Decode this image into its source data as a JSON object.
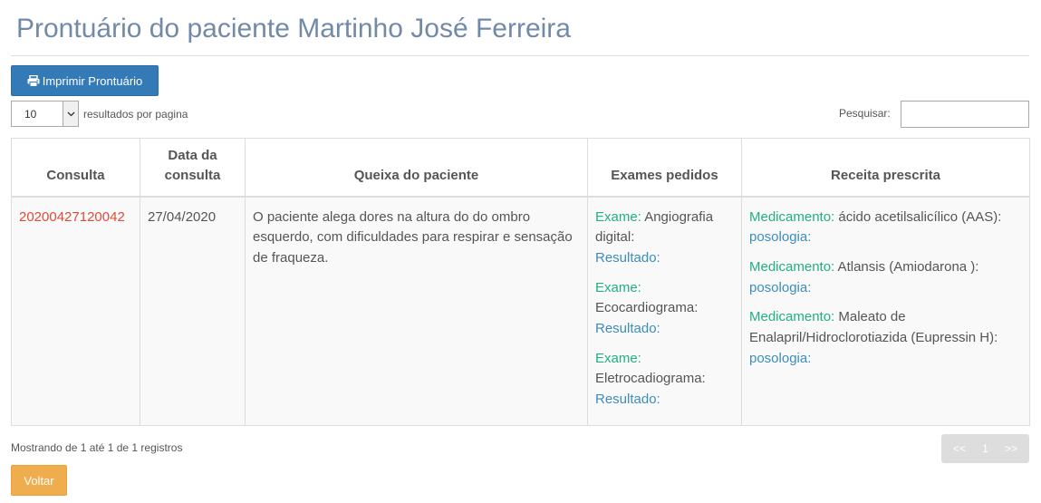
{
  "page": {
    "title": "Prontuário do paciente Martinho José Ferreira"
  },
  "toolbar": {
    "print_label": "Imprimir Prontuário",
    "print_icon": "printer-icon"
  },
  "table_controls": {
    "page_length_value": "10",
    "page_length_label": "resultados por pagina",
    "search_label": "Pesquisar:",
    "search_value": ""
  },
  "table": {
    "columns": [
      "Consulta",
      "Data da consulta",
      "Queixa do paciente",
      "Exames pedidos",
      "Receita prescrita"
    ],
    "rows": [
      {
        "consulta": "20200427120042",
        "data": "27/04/2020",
        "queixa": "O paciente alega dores na altura do do ombro esquerdo, com dificuldades para respirar e sensação de fraqueza.",
        "exames": [
          {
            "label": "Exame:",
            "name": " Angiografia digital:",
            "result_label": "Resultado:"
          },
          {
            "label": "Exame:",
            "name": " Ecocardiograma:",
            "result_label": "Resultado:"
          },
          {
            "label": "Exame:",
            "name": " Eletrocadiograma:",
            "result_label": "Resultado:"
          }
        ],
        "receitas": [
          {
            "label": "Medicamento:",
            "name": " ácido acetilsalicílico (AAS):",
            "dose_label": "posologia:"
          },
          {
            "label": "Medicamento:",
            "name": " Atlansis (Amiodarona ):",
            "dose_label": "posologia:"
          },
          {
            "label": "Medicamento:",
            "name": " Maleato de Enalapril/Hidroclorotiazida (Eupressin H):",
            "dose_label": "posologia:"
          }
        ]
      }
    ]
  },
  "footer": {
    "info": "Mostrando de 1 até 1 de 1 registros",
    "pager": {
      "prev": "<<",
      "current": "1",
      "next": ">>"
    },
    "back_label": "Voltar"
  },
  "colors": {
    "title": "#7289a8",
    "primary_button": "#337ab7",
    "warning_button": "#f0ad4e",
    "consulta_link": "#dd4b39",
    "label_green": "#22b07d",
    "label_blue": "#3c8dbc"
  }
}
